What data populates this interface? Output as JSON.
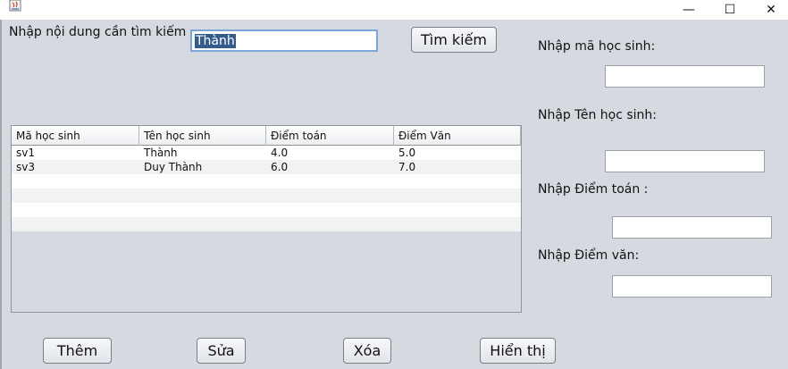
{
  "search": {
    "label": "Nhập nội dung cần tìm kiếm",
    "value": "Thành",
    "button_label": "Tìm kiếm"
  },
  "table": {
    "columns": [
      "Mã học sinh",
      "Tên học sinh",
      "Điểm toán",
      "Điểm Văn"
    ],
    "rows": [
      [
        "sv1",
        "Thành",
        "4.0",
        "5.0"
      ],
      [
        "sv3",
        "Duy Thành",
        "6.0",
        "7.0"
      ]
    ]
  },
  "form": {
    "ma_label": "Nhập mã học sinh:",
    "ma_value": "",
    "ten_label": "Nhập Tên học sinh:",
    "ten_value": "",
    "toan_label": "Nhập Điểm toán :",
    "toan_value": "",
    "van_label": "Nhập Điểm văn:",
    "van_value": ""
  },
  "actions": {
    "them": "Thêm",
    "sua": "Sửa",
    "xoa": "Xóa",
    "hien_thi": "Hiển thị"
  },
  "window": {
    "minimize_glyph": "—",
    "maximize_glyph": "☐",
    "close_glyph": "✕",
    "icon": "java-app-icon"
  }
}
